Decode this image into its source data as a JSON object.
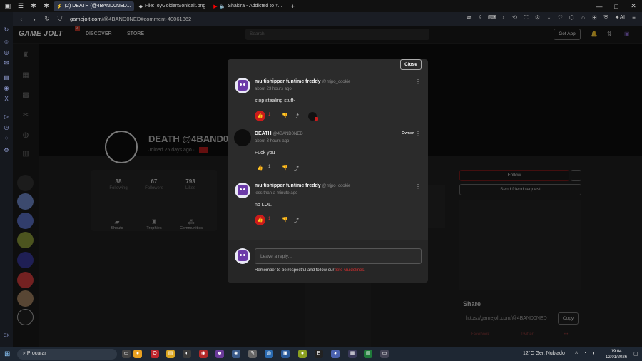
{
  "browser": {
    "tabs": [
      {
        "label": "(2) DEATH (@4BAND0NED...",
        "active": true
      },
      {
        "label": "File:ToyGoldenSonicalt.png",
        "active": false
      },
      {
        "label": "Shakira - Addicted to Y...",
        "active": false
      }
    ],
    "url_host": "gamejolt.com",
    "url_path": "/@4BAND0NED#comment-40061362"
  },
  "gamejolt": {
    "logo": "GAME JOLT",
    "logo_badge": "2",
    "nav": [
      "DISCOVER",
      "STORE"
    ],
    "search_placeholder": "Search",
    "get_app": "Get App"
  },
  "profile": {
    "name": "DEATH @4BAND0NED",
    "joined": "Joined 25 days ago",
    "stats": [
      {
        "value": "38",
        "label": "Following"
      },
      {
        "value": "67",
        "label": "Followers"
      },
      {
        "value": "793",
        "label": "Likes"
      }
    ],
    "links": [
      "Shouts",
      "Trophies",
      "Communities"
    ],
    "follow": "Follow",
    "send_friend": "Send friend request",
    "share_title": "Share",
    "share_url": "https://gamejolt.com/@4BAND0NED",
    "copy": "Copy",
    "facebook": "Facebook",
    "twitter": "Twitter"
  },
  "modal": {
    "close": "Close",
    "comments": [
      {
        "author": "multishipper funtime freddy",
        "handle": "@mjpo_cookie",
        "time": "about 23 hours ago",
        "text": "stop stealing stuff-",
        "likes": "1",
        "liked": true
      },
      {
        "author": "DEATH",
        "handle": "@4BAND0NED",
        "time": "about 3 hours ago",
        "text": "Fuck you",
        "likes": "1",
        "liked": false,
        "badge": "Owner"
      },
      {
        "author": "multishipper funtime freddy",
        "handle": "@mjpo_cookie",
        "time": "less than a minute ago",
        "text": "no LOL.",
        "likes": "1",
        "liked": true
      }
    ],
    "reply_placeholder": "Leave a reply...",
    "reply_note_prefix": "Remember to be respectful and follow our ",
    "reply_note_link": "Site Guidelines",
    "reply_note_suffix": "."
  },
  "taskbar": {
    "search": "Procurar",
    "weather": "12°C  Ger. Nublado",
    "time": "19:04",
    "date": "12/01/2026"
  },
  "colors": {
    "accent_red": "#cc1b1b",
    "modal_bg": "#2b2b2b",
    "purple_avatar": "#6b3aa8"
  }
}
